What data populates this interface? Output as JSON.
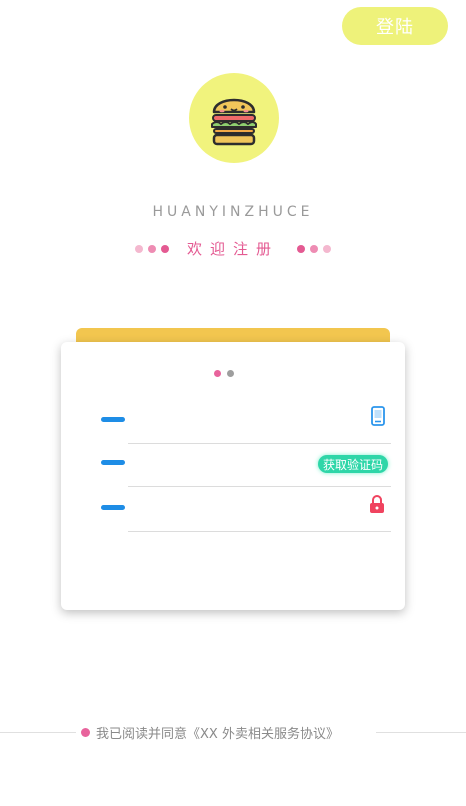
{
  "header": {
    "login_label": "登陆"
  },
  "brand": {
    "title": "HUANYINZHUCE",
    "welcome": "欢迎注册"
  },
  "form": {
    "phone": {
      "placeholder": "",
      "icon": "phone-icon"
    },
    "code": {
      "placeholder": "",
      "button_label": "获取验证码"
    },
    "password": {
      "placeholder": "",
      "icon": "lock-icon"
    }
  },
  "agreement": {
    "text": "我已阅读并同意《XX 外卖相关服务协议》"
  },
  "colors": {
    "accent_yellow": "#eef27a",
    "card_tab": "#f2c64f",
    "pink": "#e45a92",
    "blue": "#1e8de6",
    "green": "#2ed6a8",
    "red": "#f0435f"
  }
}
